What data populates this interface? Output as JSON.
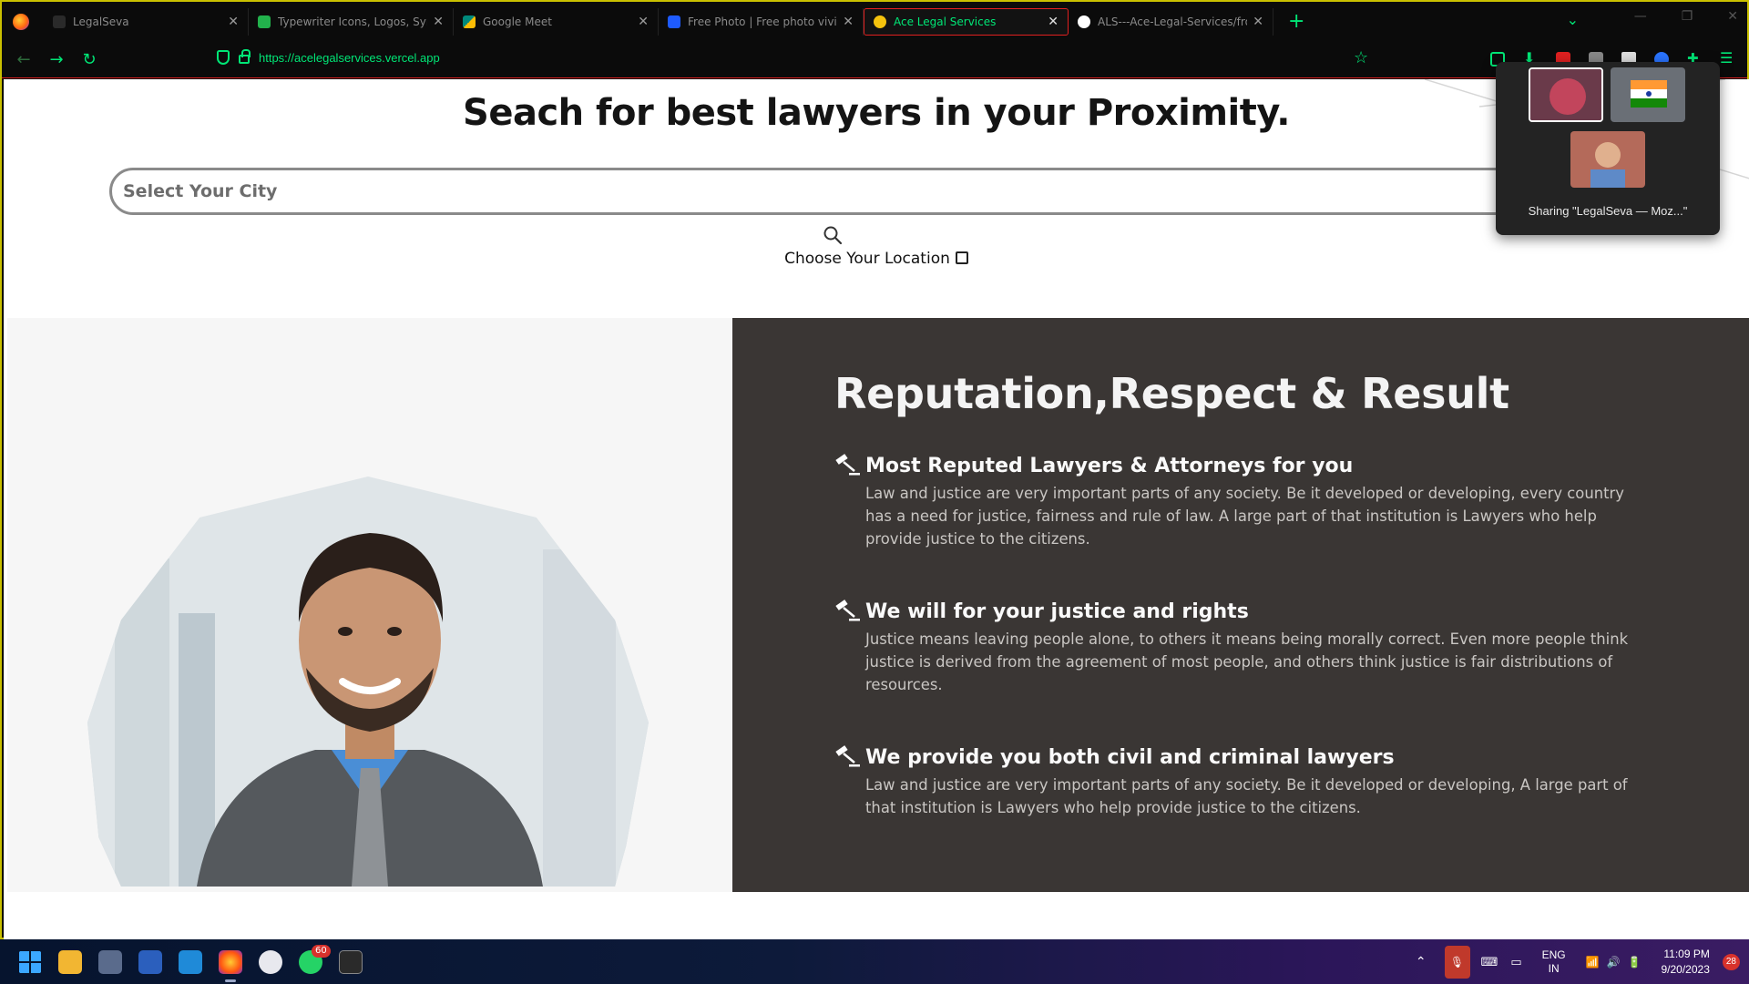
{
  "browser": {
    "tabs": [
      {
        "label": "LegalSeva",
        "favicon_color": "#3a3a3a",
        "active": false
      },
      {
        "label": "Typewriter Icons, Logos, Symbo",
        "favicon_color": "#22b24c",
        "active": false
      },
      {
        "label": "Google Meet",
        "favicon_color": "#00897b",
        "active": false
      },
      {
        "label": "Free Photo | Free photo vivid bl",
        "favicon_color": "#1e5bff",
        "active": false
      },
      {
        "label": "Ace Legal Services",
        "favicon_color": "#f4c20d",
        "active": true
      },
      {
        "label": "ALS---Ace-Legal-Services/front",
        "favicon_color": "#ffffff",
        "active": false
      }
    ],
    "new_tab": "+",
    "url": "https://acelegalservices.vercel.app",
    "accent_color": "#00e676",
    "active_tab_border": "#e02020"
  },
  "page": {
    "headline": "Seach for best lawyers in your Proximity.",
    "city_placeholder": "Select Your City",
    "choose_location": "Choose Your Location",
    "section_title": "Reputation,Respect & Result",
    "features": [
      {
        "title": "Most Reputed Lawyers & Attorneys for you",
        "body": "Law and justice are very important parts of any society. Be it developed or developing, every country has a need for justice, fairness and rule of law. A large part of that institution is Lawyers who help provide justice to the citizens."
      },
      {
        "title": "We will for your justice and rights",
        "body": "Justice means leaving people alone, to others it means being morally correct. Even more people think justice is derived from the agreement of most people, and others think justice is fair distributions of resources."
      },
      {
        "title": "We provide you both civil and criminal lawyers",
        "body": "Law and justice are very important parts of any society. Be it developed or developing, A large part of that institution is Lawyers who help provide justice to the citizens."
      }
    ]
  },
  "sharing_popup": {
    "text": "Sharing \"LegalSeva — Moz...\""
  },
  "taskbar": {
    "whatsapp_badge": "60",
    "language_top": "ENG",
    "language_bottom": "IN",
    "time": "11:09 PM",
    "date": "9/20/2023",
    "notification_count": "28"
  }
}
